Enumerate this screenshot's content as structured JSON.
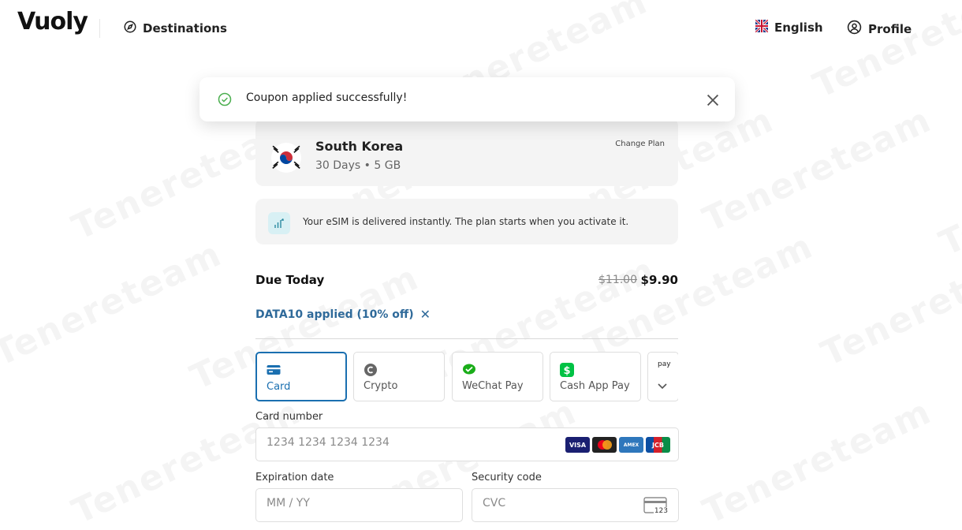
{
  "header": {
    "logo": "Vuoly",
    "nav_destinations": "Destinations",
    "language": "English",
    "profile": "Profile"
  },
  "toast": {
    "message": "Coupon applied successfully!"
  },
  "plan": {
    "country": "South Korea",
    "details": "30 Days • 5 GB",
    "change_label": "Change Plan"
  },
  "info": {
    "text": "Your eSIM is delivered instantly. The plan starts when you activate it."
  },
  "due": {
    "label": "Due Today",
    "original_price": "$11.00",
    "price": "$9.90"
  },
  "coupon": {
    "text": "DATA10 applied (10% off)",
    "remove": "✕"
  },
  "payment_methods": [
    {
      "label": "Card",
      "active": true
    },
    {
      "label": "Crypto",
      "active": false
    },
    {
      "label": "WeChat Pay",
      "active": false
    },
    {
      "label": "Cash App Pay",
      "active": false
    },
    {
      "label": "pay",
      "active": false
    }
  ],
  "card_form": {
    "card_number_label": "Card number",
    "card_number_placeholder": "1234 1234 1234 1234",
    "expiry_label": "Expiration date",
    "expiry_placeholder": "MM / YY",
    "cvc_label": "Security code",
    "cvc_placeholder": "CVC",
    "cvc_icon_text": "123",
    "brands": [
      "VISA",
      "AMEX",
      "JCB"
    ]
  },
  "watermark": "Tenereteam",
  "colors": {
    "accent": "#1a6fb0",
    "coupon": "#2f6a9a",
    "success": "#4caf50"
  }
}
